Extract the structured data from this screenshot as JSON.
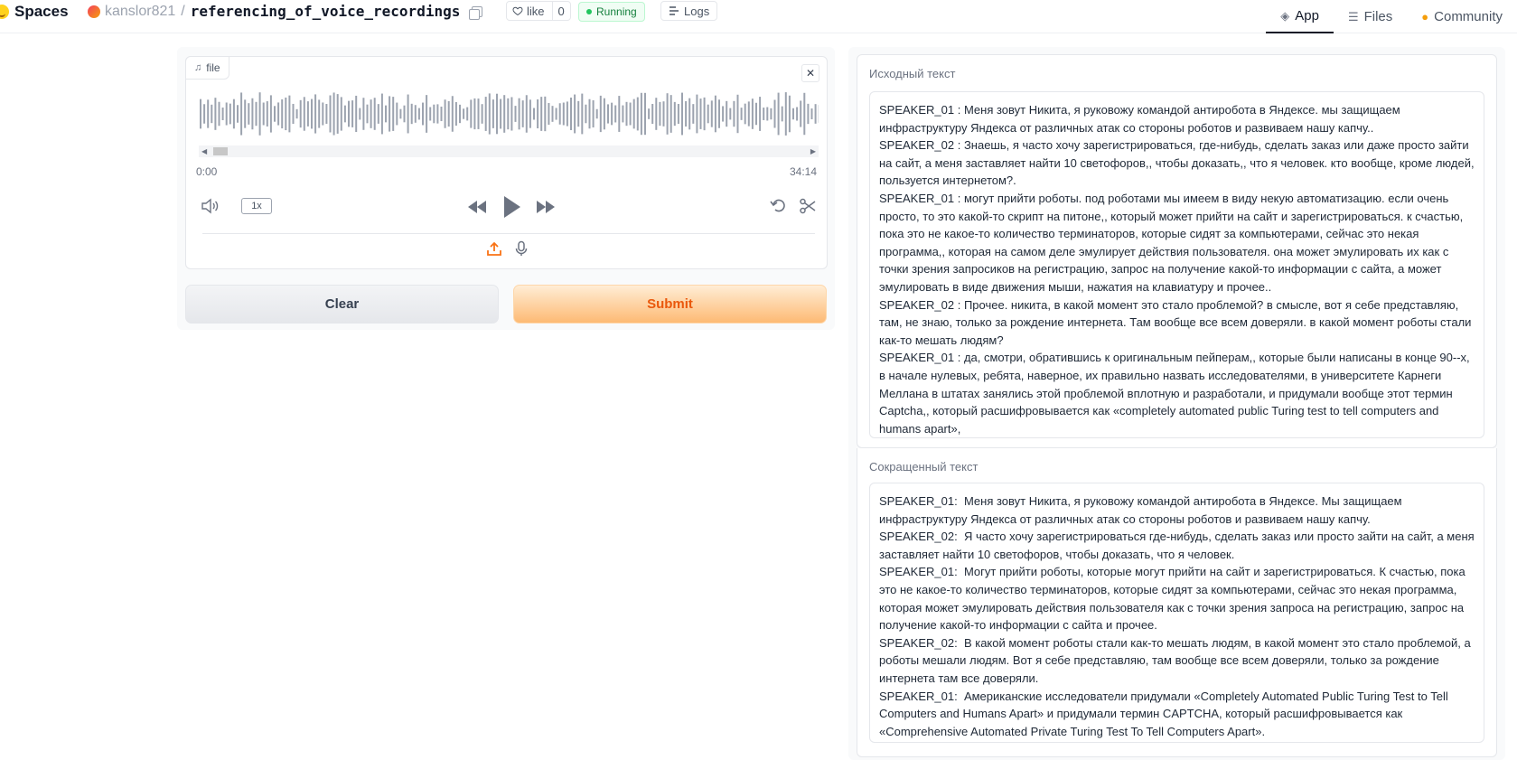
{
  "header": {
    "brand": "Spaces",
    "owner": "kanslor821",
    "separator": "/",
    "repo": "referencing_of_voice_recordings",
    "like_label": "like",
    "like_count": "0",
    "status": "Running",
    "logs_label": "Logs",
    "tabs": [
      {
        "label": "App",
        "icon": "cube-icon",
        "active": true
      },
      {
        "label": "Files",
        "icon": "files-icon",
        "active": false
      },
      {
        "label": "Community",
        "icon": "community-icon",
        "active": false
      }
    ]
  },
  "audio": {
    "file_label": "file",
    "time_start": "0:00",
    "time_end": "34:14",
    "rate": "1x"
  },
  "buttons": {
    "clear": "Clear",
    "submit": "Submit"
  },
  "source": {
    "label": "Исходный текст",
    "text": "SPEAKER_01 : Меня зовут Никита, я руковожу командой антиробота в Яндексе. мы защищаем инфраструктуру Яндекса от различных атак со стороны роботов и развиваем нашу капчу..\nSPEAKER_02 : Знаешь, я часто хочу зарегистрироваться, где-нибудь, сделать заказ или даже просто зайти на сайт, а меня заставляет найти 10 светофоров,, чтобы доказать,, что я человек. кто вообще, кроме людей, пользуется интернетом?.\nSPEAKER_01 : могут прийти роботы. под роботами мы имеем в виду некую автоматизацию. если очень просто, то это какой-то скрипт на питоне,, который может прийти на сайт и зарегистрироваться. к счастью, пока это не какое-то количество терминаторов, которые сидят за компьютерами, сейчас это некая программа,, которая на самом деле эмулирует действия пользователя. она может эмулировать их как с точки зрения запросиков на регистрацию, запрос на получение какой-то информации с сайта, а может эмулировать в виде движения мыши, нажатия на клавиатуру и прочее..\nSPEAKER_02 : Прочее. никита, в какой момент это стало проблемой? в смысле, вот я себе представляю, там, не знаю, только за рождение интернета. Там вообще все всем доверяли. в какой момент роботы стали как-то мешать людям?\nSPEAKER_01 : да, смотри, обратившись к оригинальным пейперам,, которые были написаны в конце 90--х, в начале нулевых, ребята, наверное, их правильно назвать исследователями, в университете Карнеги Меллана в штатах занялись этой проблемой вплотную и разработали, и придумали вообще этот термин Captcha,, который расшифровывается как «completely automated public Turing test to tell computers and humans apart»,"
  },
  "summary": {
    "label": "Сокращенный текст",
    "text": "SPEAKER_01:  Меня зовут Никита, я руковожу командой антиробота в Яндексе. Мы защищаем инфраструктуру Яндекса от различных атак со стороны роботов и развиваем нашу капчу.\nSPEAKER_02:  Я часто хочу зарегистрироваться где-нибудь, сделать заказ или просто зайти на сайт, а меня заставляет найти 10 светофоров, чтобы доказать, что я человек.\nSPEAKER_01:  Могут прийти роботы, которые могут прийти на сайт и зарегистрироваться. К счастью, пока это не какое-то количество терминаторов, которые сидят за компьютерами, сейчас это некая программа, которая может эмулировать действия пользователя как с точки зрения запроса на регистрацию, запрос на получение какой-то информации с сайта и прочее.\nSPEAKER_02:  В какой момент роботы стали как-то мешать людям, в какой момент это стало проблемой, а роботы мешали людям. Вот я себе представляю, там вообще все всем доверяли, только за рождение интернета там все доверяли.\nSPEAKER_01:  Американские исследователи придумали «Completely Automated Public Turing Test to Tell Computers and Humans Apart» и придумали термин CAPTCHA, который расшифровывается как «Comprehensive Automated Private Turing Test To Tell Computers Apart»."
  }
}
